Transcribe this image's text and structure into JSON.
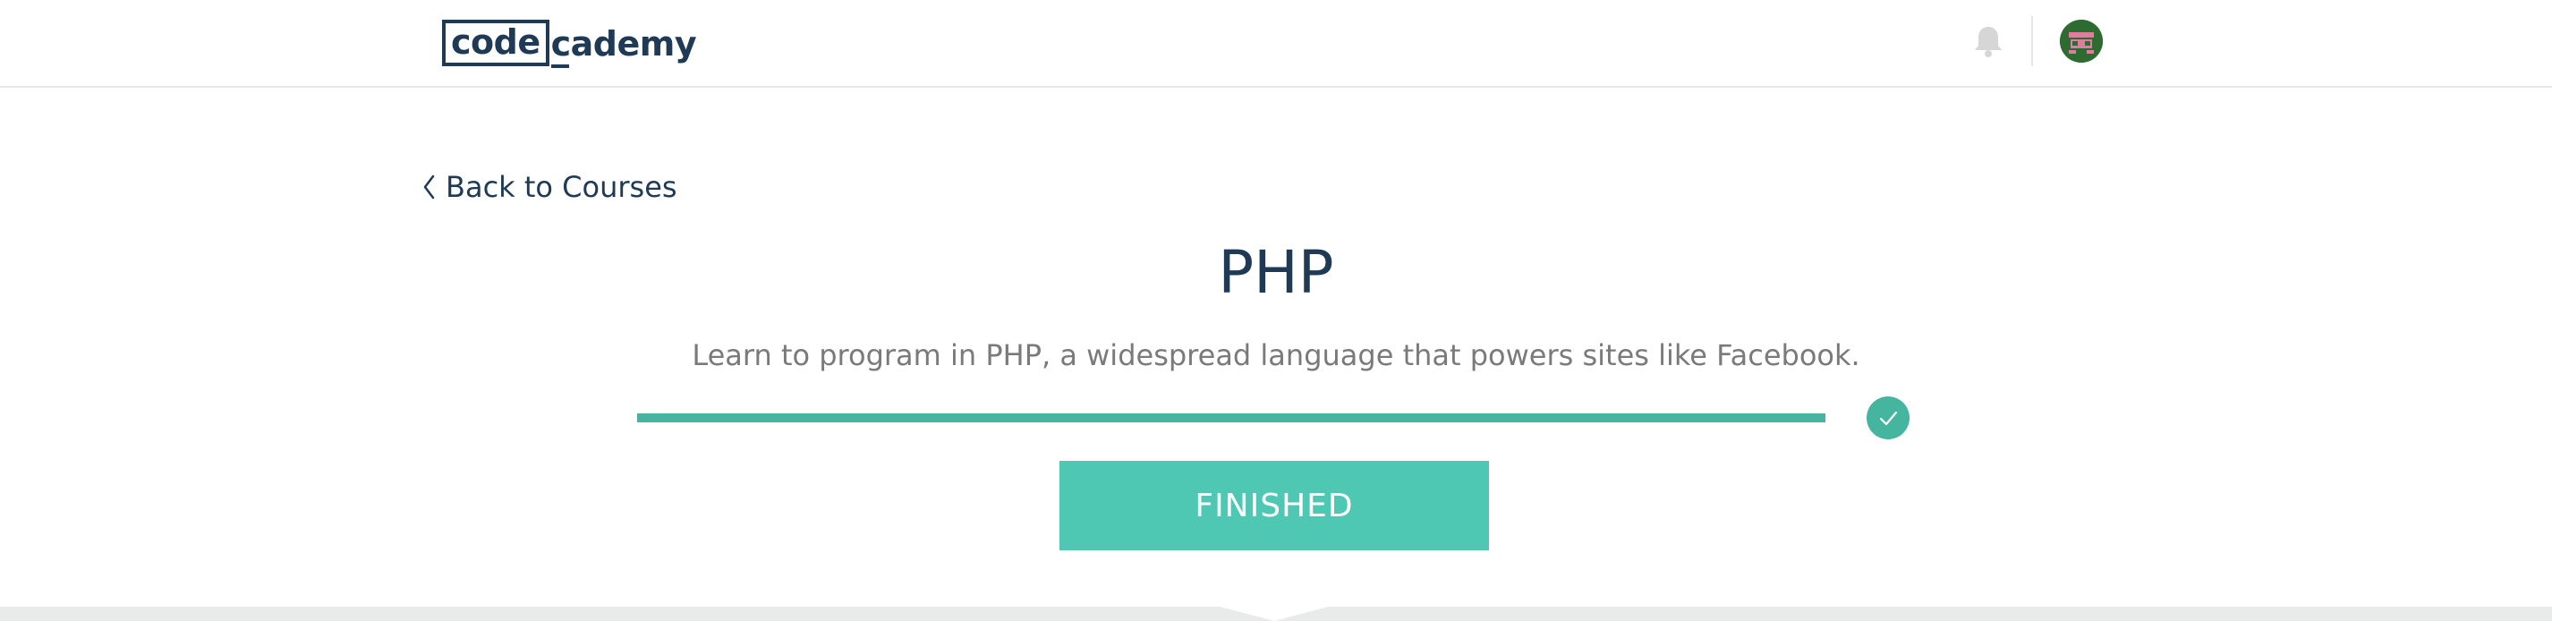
{
  "header": {
    "logo_box_text": "code",
    "logo_rest_text": "cademy",
    "notification_icon": "bell-icon",
    "avatar_icon": "avatar-icon"
  },
  "nav": {
    "back_label": "Back to Courses",
    "back_icon": "chevron-left-icon"
  },
  "course": {
    "title": "PHP",
    "description": "Learn to program in PHP, a widespread language that powers sites like Facebook.",
    "progress_fraction": 1.0,
    "progress_complete_icon": "check-icon",
    "status_button_label": "FINISHED"
  },
  "colors": {
    "brand_dark": "#1f3a55",
    "accent_teal": "#45b5a0",
    "button_teal": "#4ec7b3",
    "muted_text": "#7a7a7a"
  }
}
